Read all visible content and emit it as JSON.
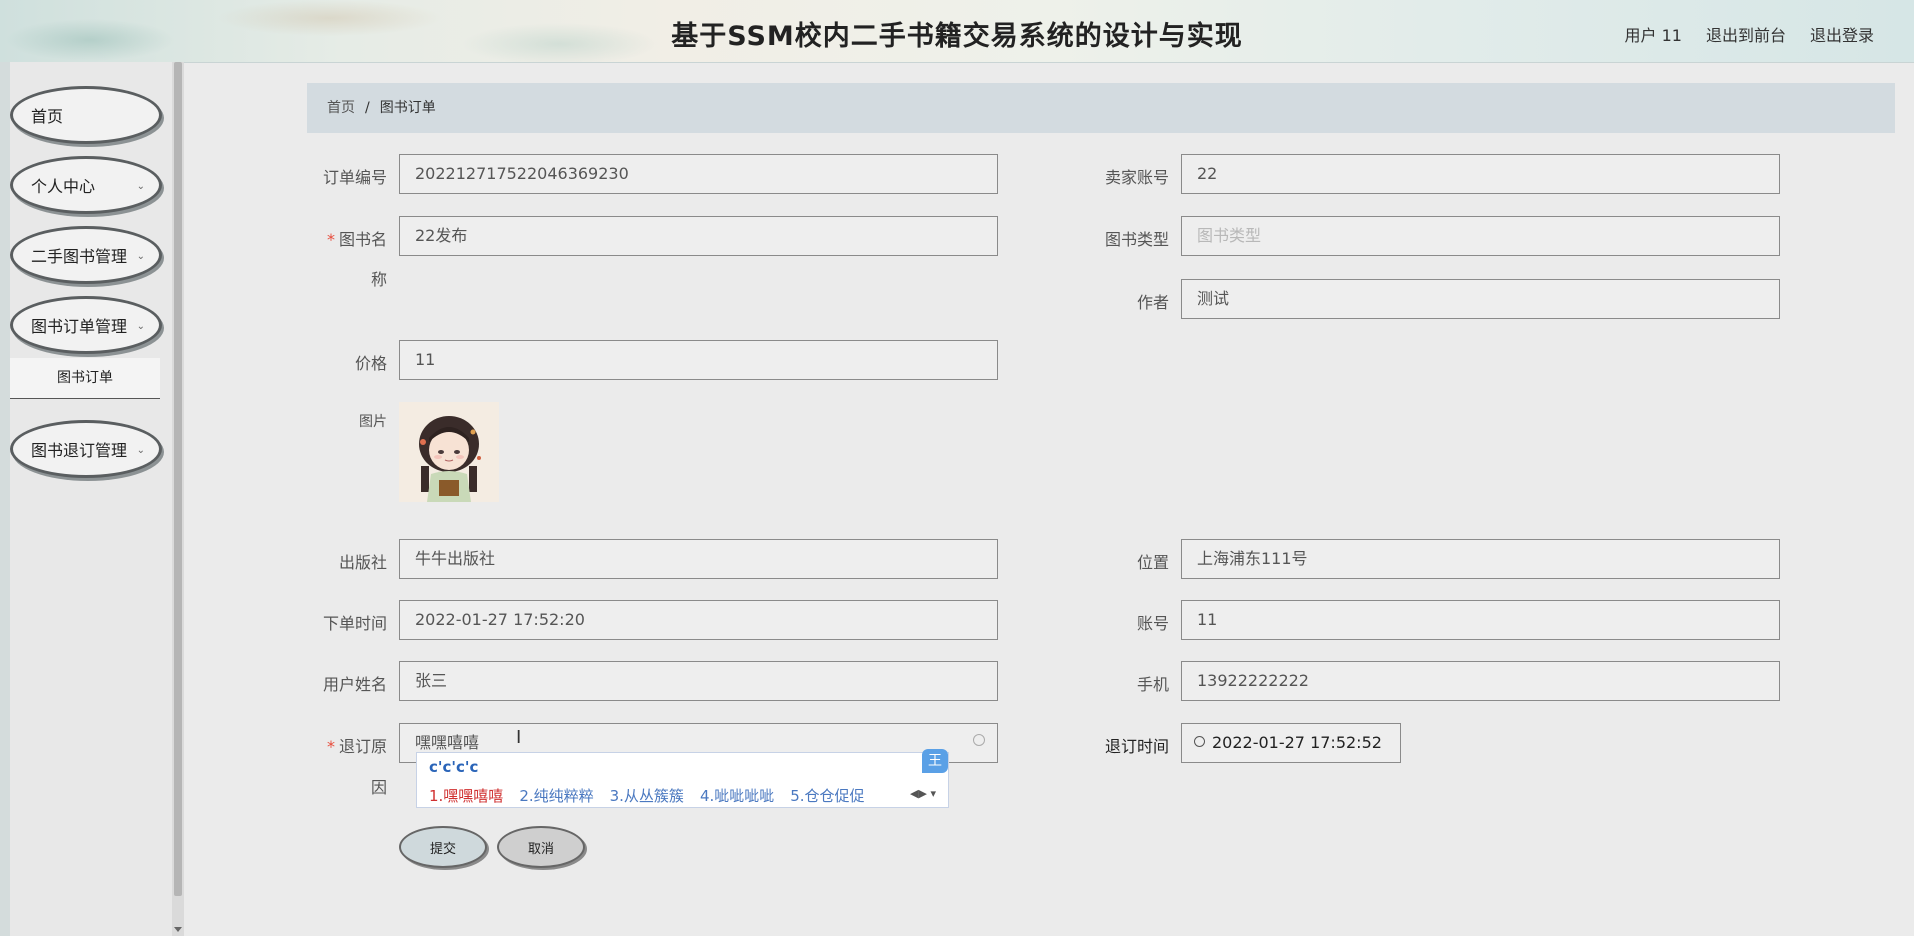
{
  "header": {
    "title": "基于SSM校内二手书籍交易系统的设计与实现",
    "user": "用户 11",
    "to_frontend": "退出到前台",
    "logout": "退出登录"
  },
  "sidebar": {
    "items": [
      {
        "label": "首页"
      },
      {
        "label": "个人中心"
      },
      {
        "label": "二手图书管理"
      },
      {
        "label": "图书订单管理"
      },
      {
        "label": "图书退订管理"
      }
    ],
    "sub_item": "图书订单"
  },
  "breadcrumb": {
    "home": "首页",
    "current": "图书订单"
  },
  "form": {
    "order_no": {
      "label": "订单编号",
      "value": "202212717522046369230"
    },
    "seller": {
      "label": "卖家账号",
      "value": "22"
    },
    "book_name": {
      "label": "图书名",
      "label_wrap": "称",
      "value": "22发布"
    },
    "book_type": {
      "label": "图书类型",
      "placeholder": "图书类型"
    },
    "author": {
      "label": "作者",
      "value": "测试"
    },
    "price": {
      "label": "价格",
      "value": "11"
    },
    "image": {
      "label": "图片"
    },
    "publisher": {
      "label": "出版社",
      "value": "牛牛出版社"
    },
    "location": {
      "label": "位置",
      "value": "上海浦东111号"
    },
    "order_time": {
      "label": "下单时间",
      "value": "2022-01-27 17:52:20"
    },
    "account": {
      "label": "账号",
      "value": "11"
    },
    "user_name": {
      "label": "用户姓名",
      "value": "张三"
    },
    "phone": {
      "label": "手机",
      "value": "13922222222"
    },
    "cancel_reason": {
      "label": "退订原",
      "label_wrap": "因",
      "value": "嘿嘿嘻嘻"
    },
    "cancel_time": {
      "label": "退订时间",
      "value": "2022-01-27 17:52:52"
    },
    "required_mark": "*"
  },
  "buttons": {
    "submit": "提交",
    "cancel": "取消"
  },
  "ime": {
    "composition": "c'c'c'c",
    "logo": "王",
    "candidates": [
      "1.嘿嘿嘻嘻",
      "2.纯纯粹粹",
      "3.从丛簇簇",
      "4.呲呲呲呲",
      "5.仓仓促促"
    ]
  }
}
